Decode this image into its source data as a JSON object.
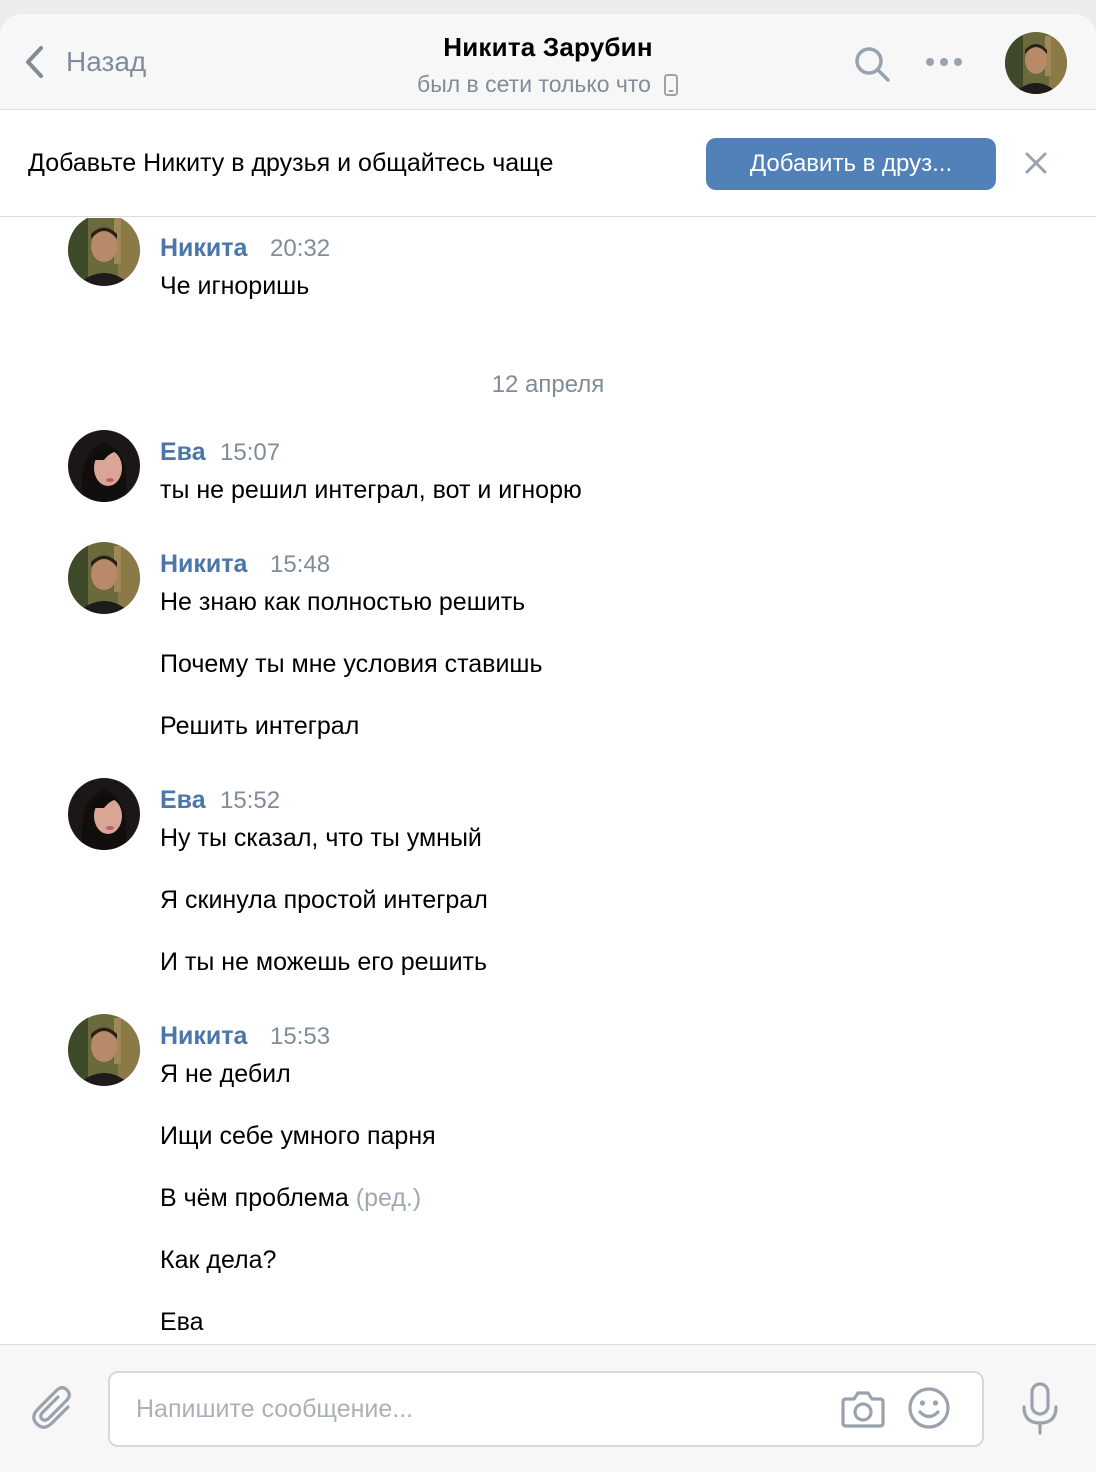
{
  "header": {
    "back_label": "Назад",
    "title": "Никита Зарубин",
    "status": "был в сети только что"
  },
  "banner": {
    "text": "Добавьте Никиту в друзья и общайтесь чаще",
    "button_label": "Добавить в друз..."
  },
  "messages": {
    "groups": [
      {
        "author": "Никита",
        "time": "20:32",
        "lines": [
          "Че игноришь"
        ]
      },
      {
        "author": "Ева",
        "time": "15:07",
        "lines": [
          "ты не решил интеграл, вот и игнорю"
        ]
      },
      {
        "author": "Никита",
        "time": "15:48",
        "lines": [
          "Не знаю как полностью решить",
          "Почему ты мне условия ставишь",
          "Решить интеграл"
        ]
      },
      {
        "author": "Ева",
        "time": "15:52",
        "lines": [
          "Ну ты сказал, что ты умный",
          "Я скинула простой интеграл",
          "И ты не можешь его решить"
        ]
      },
      {
        "author": "Никита",
        "time": "15:53",
        "lines": [
          "Я не дебил",
          "Ищи себе умного парня",
          "В чём проблема",
          "Как дела?",
          "Ева"
        ],
        "edited_note": "(ред.)"
      }
    ],
    "date_separator": "12 апреля"
  },
  "composer": {
    "placeholder": "Напишите сообщение..."
  },
  "colors": {
    "accent": "#5181b8",
    "author": "#4a76a8",
    "secondary": "#818c99"
  }
}
